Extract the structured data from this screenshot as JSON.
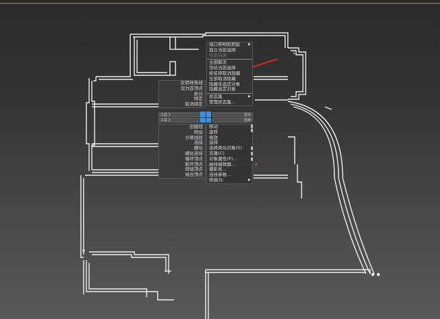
{
  "quad_menu": {
    "top_right": [
      {
        "label": "视口照明和阴影",
        "arrow": "▶",
        "disabled": false
      },
      {
        "label": "孤立当前选择",
        "disabled": false
      },
      {
        "label": "结束隔离",
        "disabled": true
      },
      {
        "sep": true
      },
      {
        "label": "全部解冻",
        "disabled": false
      },
      {
        "label": "冻结当前选择",
        "disabled": false
      },
      {
        "label": "按名称取消隐藏",
        "disabled": false
      },
      {
        "label": "全部取消隐藏",
        "disabled": false
      },
      {
        "label": "隐藏未选定对象",
        "disabled": false
      },
      {
        "label": "隐藏选定对象",
        "disabled": false
      },
      {
        "sep": true
      },
      {
        "label": "状态集",
        "arrow": "▶",
        "disabled": false
      },
      {
        "label": "管理状态集...",
        "disabled": false
      }
    ],
    "top_left": [
      {
        "label": "反转样条线"
      },
      {
        "label": "设为首顶点"
      },
      {
        "label": "拆分"
      },
      {
        "label": "绑定"
      },
      {
        "label": "取消绑定"
      }
    ],
    "bottom_left": [
      {
        "label": "创建线"
      },
      {
        "label": "附加"
      },
      {
        "label": "分离线段"
      },
      {
        "label": "连接"
      },
      {
        "label": "细化"
      },
      {
        "label": "细化连接"
      },
      {
        "label": "循环顶点"
      },
      {
        "label": "断开顶点"
      },
      {
        "label": "焊接顶点"
      },
      {
        "label": "熔合顶点"
      }
    ],
    "bottom_right": [
      {
        "label": "移动"
      },
      {
        "label": "旋转"
      },
      {
        "label": "缩放"
      },
      {
        "label": "选择"
      },
      {
        "label": "选择类似对象(S)"
      },
      {
        "label": "克隆(C)"
      },
      {
        "label": "对象属性(P)..."
      },
      {
        "label": "曲线编辑器..."
      },
      {
        "label": "摄影表..."
      },
      {
        "label": "连线参数..."
      },
      {
        "label": "转换为:",
        "arrow": "▶"
      }
    ],
    "headers": {
      "tl": "工具 1",
      "tr": "显示",
      "bl": "工具 2",
      "br": "变换"
    }
  }
}
